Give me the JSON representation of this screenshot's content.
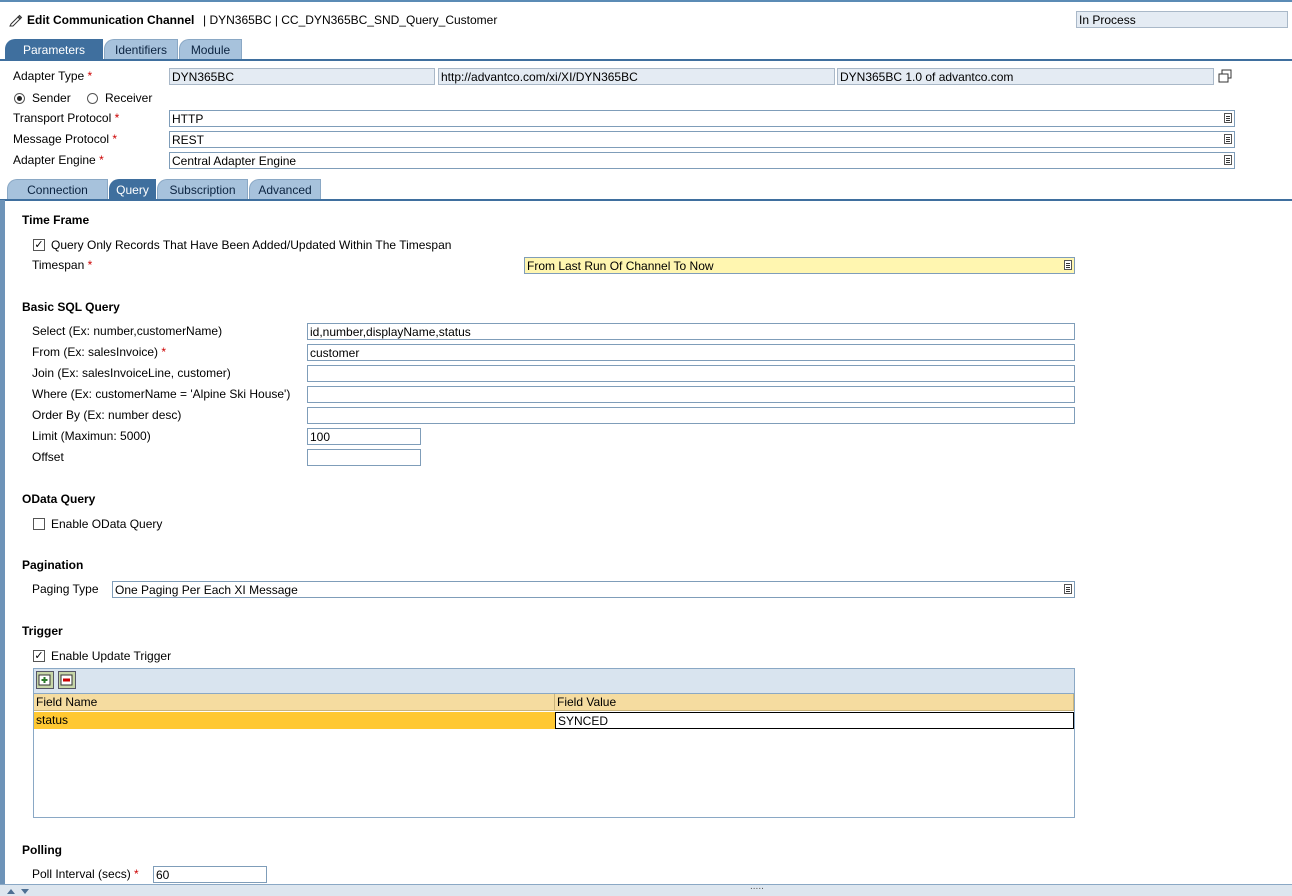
{
  "header": {
    "title": "Edit Communication Channel",
    "subtitle": "| DYN365BC | CC_DYN365BC_SND_Query_Customer",
    "status": "In Process"
  },
  "main_tabs": [
    "Parameters",
    "Identifiers",
    "Module"
  ],
  "adapter": {
    "type_label": "Adapter Type",
    "type_value": "DYN365BC",
    "namespace": "http://advantco.com/xi/XI/DYN365BC",
    "swcv": "DYN365BC 1.0 of advantco.com",
    "sender_label": "Sender",
    "receiver_label": "Receiver",
    "transport_label": "Transport Protocol",
    "transport_value": "HTTP",
    "message_label": "Message Protocol",
    "message_value": "REST",
    "engine_label": "Adapter Engine",
    "engine_value": "Central Adapter Engine"
  },
  "sub_tabs": [
    "Connection",
    "Query",
    "Subscription",
    "Advanced"
  ],
  "time_frame": {
    "heading": "Time Frame",
    "checkbox_label": "Query Only Records That Have Been Added/Updated Within The Timespan",
    "timespan_label": "Timespan",
    "timespan_value": "From Last Run Of Channel To Now"
  },
  "sql": {
    "heading": "Basic SQL Query",
    "select_label": "Select (Ex: number,customerName)",
    "select_value": "id,number,displayName,status",
    "from_label": "From (Ex: salesInvoice)",
    "from_value": "customer",
    "join_label": "Join (Ex: salesInvoiceLine, customer)",
    "join_value": "",
    "where_label": "Where (Ex: customerName = 'Alpine Ski House')",
    "where_value": "",
    "order_label": "Order By (Ex: number desc)",
    "order_value": "",
    "limit_label": "Limit (Maximun: 5000)",
    "limit_value": "100",
    "offset_label": "Offset",
    "offset_value": ""
  },
  "odata": {
    "heading": "OData Query",
    "checkbox_label": "Enable OData Query"
  },
  "pagination": {
    "heading": "Pagination",
    "paging_label": "Paging Type",
    "paging_value": "One Paging Per Each XI Message"
  },
  "trigger": {
    "heading": "Trigger",
    "checkbox_label": "Enable Update Trigger",
    "columns": [
      "Field Name",
      "Field Value"
    ],
    "rows": [
      {
        "name": "status",
        "value": "SYNCED"
      }
    ]
  },
  "polling": {
    "heading": "Polling",
    "interval_label": "Poll Interval (secs)",
    "interval_value": "60"
  },
  "required_mark": "*",
  "grip": "....."
}
